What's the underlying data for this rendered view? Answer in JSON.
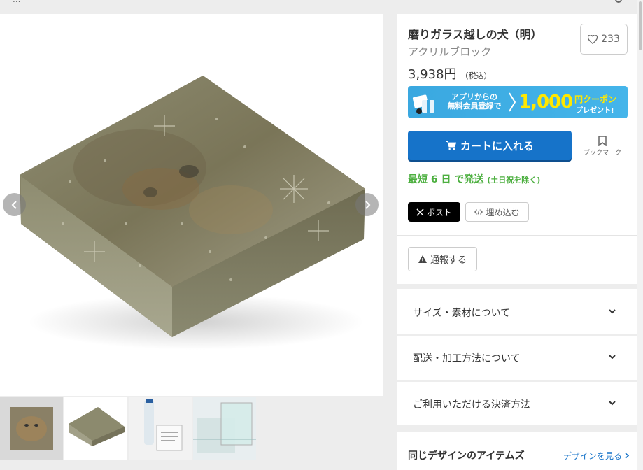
{
  "topbar": {
    "crumb": "..."
  },
  "product": {
    "title": "磨りガラス越しの犬（明）",
    "subtitle": "アクリルブロック",
    "price": "3,938円",
    "tax_note": "（税込）",
    "like_count": "233"
  },
  "banner": {
    "line1": "アプリからの",
    "line2": "無料会員登録で",
    "amount": "1,000",
    "coupon": "円クーポン",
    "present": "プレゼント!"
  },
  "actions": {
    "cart_label": "カートに入れる",
    "bookmark_label": "ブックマーク",
    "shipping_main": "最短 6 日 で発送",
    "shipping_note": "(土日祝を除く)",
    "post_label": "ポスト",
    "embed_label": "埋め込む",
    "report_label": "通報する"
  },
  "accordions": [
    {
      "label": "サイズ・素材について"
    },
    {
      "label": "配送・加工方法について"
    },
    {
      "label": "ご利用いただける決済方法"
    }
  ],
  "same_design": {
    "heading": "同じデザインのアイテムズ",
    "link": "デザインを見る"
  },
  "colors": {
    "primary": "#1673c9",
    "ship_green": "#4caf3f",
    "banner_blue": "#3aa8e0",
    "banner_yellow": "#ffe800"
  },
  "icons": {
    "like": "heart-icon",
    "cart": "cart-icon",
    "bookmark": "bookmark-icon",
    "x": "x-logo-icon",
    "embed": "code-icon",
    "report": "warning-icon",
    "chevron": "chevron-down-icon",
    "prev": "chevron-left-icon",
    "next": "chevron-right-icon"
  }
}
